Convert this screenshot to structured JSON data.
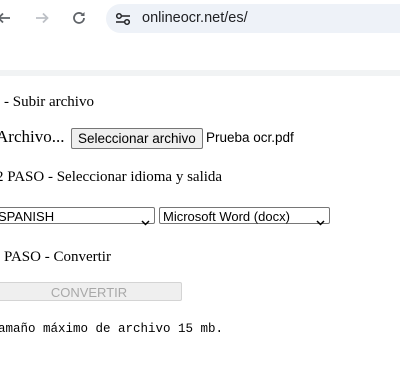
{
  "browser": {
    "url": "onlineocr.net/es/",
    "back_icon": "back-arrow-icon",
    "forward_icon": "forward-arrow-icon",
    "reload_icon": "reload-icon",
    "site_info_icon": "site-info-tune-icon"
  },
  "form": {
    "step1_title": "- Subir archivo",
    "file_label": "Archivo...",
    "file_button": "Seleccionar archivo",
    "file_name": "Prueba ocr.pdf",
    "step2_title": "2 PASO - Seleccionar idioma y salida",
    "language_selected": "SPANISH",
    "output_selected": "Microsoft Word (docx)",
    "step3_title": "PASO - Convertir",
    "convert_button": "CONVERTIR",
    "size_note": "amaño máximo de archivo 15 mb."
  },
  "colors": {
    "omnibox_bg": "#eef2f8",
    "disabled_text": "#a8a8a8"
  }
}
